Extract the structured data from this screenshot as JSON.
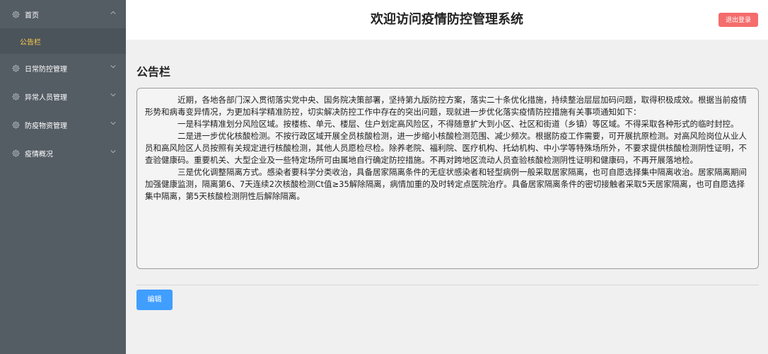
{
  "header": {
    "title": "欢迎访问疫情防控管理系统",
    "logout_label": "退出登录"
  },
  "sidebar": {
    "items": [
      {
        "label": "首页",
        "icon": "gear-icon",
        "expanded": true,
        "children": [
          {
            "label": "公告栏",
            "active": true
          }
        ]
      },
      {
        "label": "日常防控管理",
        "icon": "gear-icon"
      },
      {
        "label": "异常人员管理",
        "icon": "gear-icon"
      },
      {
        "label": "防疫物资管理",
        "icon": "gear-icon"
      },
      {
        "label": "疫情概况",
        "icon": "gear-icon"
      }
    ]
  },
  "main": {
    "title": "公告栏",
    "notice_paragraphs": [
      "近期，各地各部门深入贯彻落实党中央、国务院决策部署，坚持第九版防控方案，落实二十条优化措施，持续整治层层加码问题，取得积极成效。根据当前疫情形势和病毒变异情况，为更加科学精准防控，切实解决防控工作中存在的突出问题，现就进一步优化落实疫情防控措施有关事项通知如下：",
      "一是科学精准划分风险区域。按楼栋、单元、楼层、住户划定高风险区，不得随意扩大到小区、社区和街道（乡镇）等区域。不得采取各种形式的临时封控。",
      "二是进一步优化核酸检测。不按行政区域开展全员核酸检测，进一步缩小核酸检测范围、减少频次。根据防疫工作需要，可开展抗原检测。对高风险岗位从业人员和高风险区人员按照有关规定进行核酸检测，其他人员愿检尽检。除养老院、福利院、医疗机构、托幼机构、中小学等特殊场所外，不要求提供核酸检测阴性证明，不查验健康码。重要机关、大型企业及一些特定场所可由属地自行确定防控措施。不再对跨地区流动人员查验核酸检测阴性证明和健康码，不再开展落地检。",
      "三是优化调整隔离方式。感染者要科学分类收治，具备居家隔离条件的无症状感染者和轻型病例一般采取居家隔离，也可自愿选择集中隔离收治。居家隔离期间加强健康监测，隔离第6、7天连续2次核酸检测Ct值≥35解除隔离，病情加重的及时转定点医院治疗。具备居家隔离条件的密切接触者采取5天居家隔离，也可自愿选择集中隔离，第5天核酸检测阴性后解除隔离。"
    ],
    "edit_label": "编辑"
  },
  "colors": {
    "sidebar_bg": "#545c64",
    "active_text": "#ffd04b",
    "logout_bg": "#f56c6c",
    "primary": "#409eff"
  }
}
